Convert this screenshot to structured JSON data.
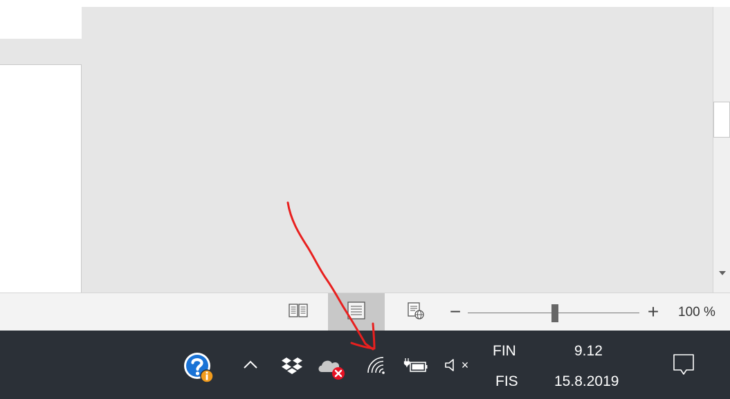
{
  "status_bar": {
    "views": [
      {
        "name": "read-mode",
        "icon": "book-icon"
      },
      {
        "name": "print-layout",
        "icon": "page-layout-icon",
        "active": true
      },
      {
        "name": "web-layout",
        "icon": "web-page-icon"
      }
    ],
    "zoom": {
      "minus_label": "−",
      "plus_label": "+",
      "level_text": "100 %",
      "level_percent": 100
    }
  },
  "taskbar": {
    "tray_icons": [
      "help-info-icon",
      "show-hidden-icons-chevron",
      "dropbox-icon",
      "onedrive-error-icon",
      "wifi-icon",
      "battery-charging-icon",
      "speaker-muted-icon"
    ],
    "chevron_glyph": "^",
    "muted_glyph": "×",
    "language": {
      "top": "FIN",
      "bottom": "FIS"
    },
    "clock": {
      "time": "9.12",
      "date": "15.8.2019"
    }
  },
  "colors": {
    "taskbar_bg": "#2b3037",
    "canvas_gray": "#e6e6e6",
    "status_bg": "#f3f3f3",
    "annotation_red": "#e8201f",
    "help_blue": "#1a73d6",
    "warning_orange": "#f29b1c",
    "error_red": "#e81123"
  }
}
